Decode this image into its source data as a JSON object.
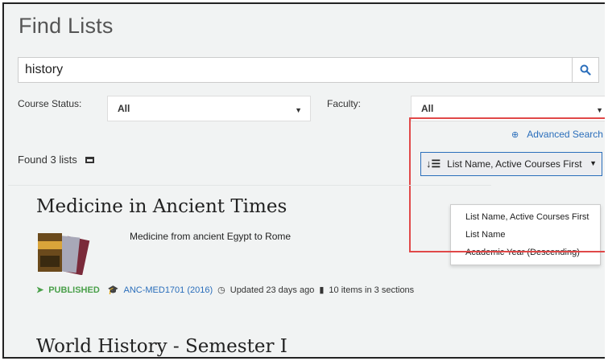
{
  "page": {
    "title": "Find Lists"
  },
  "search": {
    "value": "history"
  },
  "filters": {
    "course_status": {
      "label": "Course Status:",
      "value": "All"
    },
    "faculty": {
      "label": "Faculty:",
      "value": "All"
    }
  },
  "advanced_search": {
    "label": "Advanced Search"
  },
  "results_summary": {
    "text": "Found 3 lists"
  },
  "sort": {
    "selected": "List Name, Active Courses First",
    "options": [
      "List Name, Active Courses First",
      "List Name",
      "Academic Year (Descending)"
    ]
  },
  "results": [
    {
      "title": "Medicine in Ancient Times",
      "description": "Medicine from ancient Egypt to Rome",
      "status": "PUBLISHED",
      "course": "ANC-MED1701 (2016)",
      "updated": "Updated 23 days ago",
      "items": "10 items in 3 sections"
    },
    {
      "title": "World History - Semester I"
    }
  ],
  "colors": {
    "accent": "#2a6ebb",
    "published": "#4aa04a",
    "highlight": "#e04848"
  }
}
